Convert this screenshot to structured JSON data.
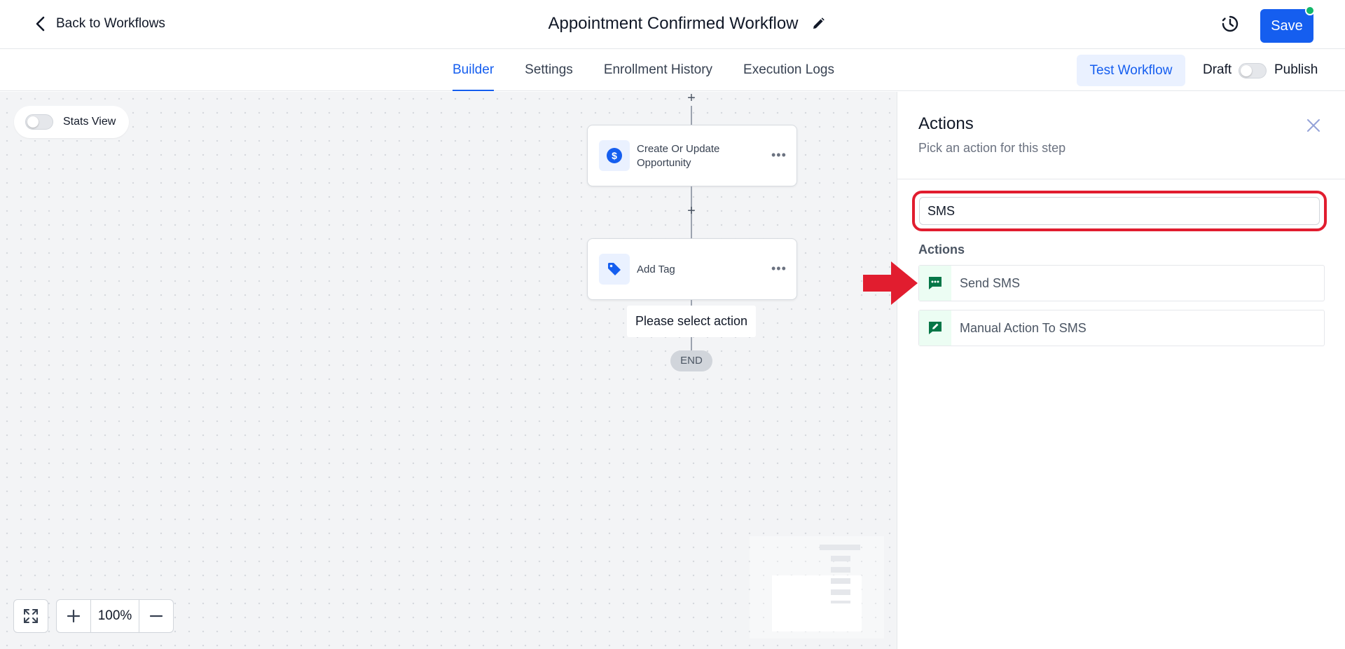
{
  "header": {
    "back_label": "Back to Workflows",
    "workflow_title": "Appointment Confirmed Workflow",
    "save_label": "Save"
  },
  "tabs": [
    {
      "label": "Builder",
      "active": true
    },
    {
      "label": "Settings",
      "active": false
    },
    {
      "label": "Enrollment History",
      "active": false
    },
    {
      "label": "Execution Logs",
      "active": false
    }
  ],
  "tabbar_actions": {
    "test_label": "Test Workflow",
    "draft_label": "Draft",
    "publish_label": "Publish",
    "published": false
  },
  "canvas": {
    "stats_view_label": "Stats View",
    "stats_view_on": false,
    "nodes": [
      {
        "label": "Create Or Update Opportunity",
        "icon": "dollar-icon"
      },
      {
        "label": "Add Tag",
        "icon": "tag-icon"
      }
    ],
    "placeholder_label": "Please select action",
    "end_label": "END",
    "zoom_level": "100%"
  },
  "panel": {
    "title": "Actions",
    "subtitle": "Pick an action for this step",
    "search_value": "SMS",
    "section_label": "Actions",
    "items": [
      {
        "label": "Send SMS",
        "icon": "message-icon"
      },
      {
        "label": "Manual Action To SMS",
        "icon": "manual-sms-icon"
      }
    ]
  },
  "colors": {
    "primary": "#155eef",
    "highlight": "#e11d2f",
    "sms_icon": "#067647",
    "status_dot": "#12b76a"
  }
}
